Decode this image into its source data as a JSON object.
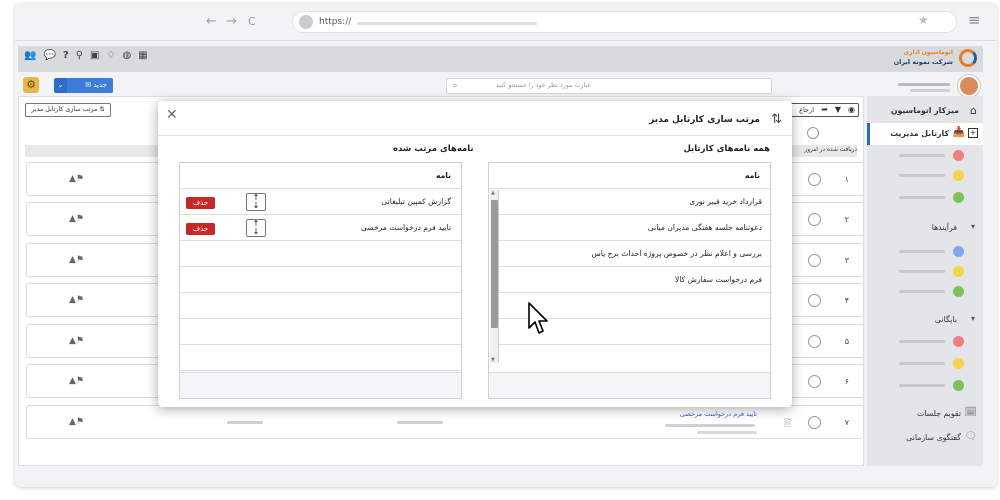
{
  "browser": {
    "url": "https://",
    "nav_back": "←",
    "nav_forward": "→",
    "nav_reload": "C",
    "star": "★",
    "menu": "≡"
  },
  "header": {
    "logo_line1": "اتوماسیون اداری",
    "logo_line2": "شرکت نمونه ایران",
    "search_placeholder": "عبارت مورد نظر خود را جستجو کنید",
    "new_button": "جدید",
    "toolbar_icons": [
      "users-icon",
      "chat-icon",
      "help-icon",
      "pin-icon",
      "image-icon",
      "bell-icon",
      "globe-icon",
      "grid-icon"
    ]
  },
  "content": {
    "tab_label": "مرتب سازی کارتابل مدیر",
    "return_label": "ارجاع",
    "received_label": "دریافت شده در امروز",
    "rows": [
      {
        "num": "۱"
      },
      {
        "num": "۲"
      },
      {
        "num": "۳"
      },
      {
        "num": "۴"
      },
      {
        "num": "۵"
      },
      {
        "num": "۶"
      },
      {
        "num": "۷",
        "title": "تایید فرم درخواست مرخصی"
      }
    ]
  },
  "sidebar": {
    "desk": "میزکار اتوماسیون",
    "cartable": "کارتابل مدیریت",
    "processes": "فرآیندها",
    "archive": "بایگانی",
    "calendar": "تقویم جلسات",
    "chat": "گفتگوی سازمانی",
    "dot_colors": [
      "#f27d7d",
      "#f6d44a",
      "#7cc35a",
      "#7fa7ec",
      "#f6d44a",
      "#7cc35a",
      "#f27d7d",
      "#f6d44a",
      "#7cc35a"
    ]
  },
  "modal": {
    "title": "مرتب سازی کارتابل مدیر",
    "left_title": "نامه‌های مرتب شده",
    "right_title": "همه نامه‌های کارتابل",
    "header": "نامه",
    "sorted": [
      {
        "title": "گزارش کمپین تبلیغاتی",
        "delete": "حذف"
      },
      {
        "title": "تایید فرم درخواست مرخصی",
        "delete": "حذف"
      }
    ],
    "all": [
      "قرارداد خرید فیبر نوری",
      "دعوتنامه جلسه هفتگی مدیران میانی",
      "بررسی و اعلام نظر در خصوص پروژه احداث برج یاس",
      "فرم درخواست سفارش کالا"
    ]
  }
}
